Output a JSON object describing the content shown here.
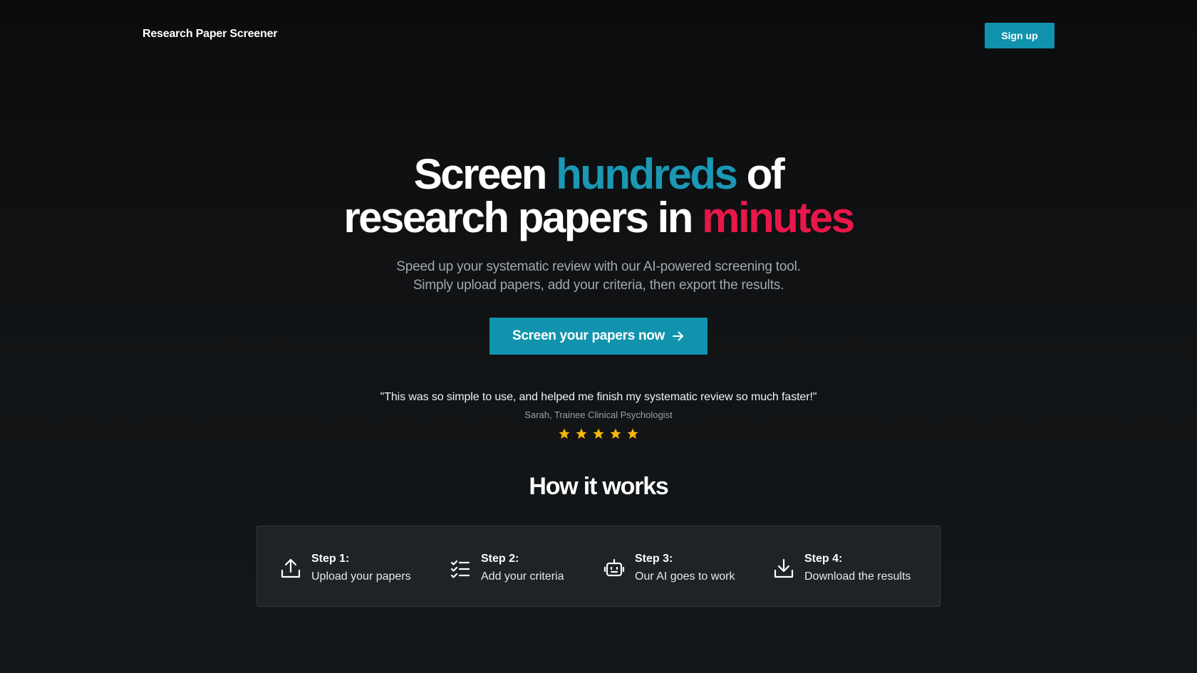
{
  "nav": {
    "brand": "Research Paper Screener",
    "signup_label": "Sign up"
  },
  "hero": {
    "headline": {
      "part1": "Screen ",
      "highlight1": "hundreds",
      "part2": " of",
      "part3": "research papers in ",
      "highlight2": "minutes"
    },
    "subtitle_line1": "Speed up your systematic review with our AI-powered screening tool.",
    "subtitle_line2": "Simply upload papers, add your criteria, then export the results.",
    "cta_label": "Screen your papers now"
  },
  "testimonial": {
    "quote": "\"This was so simple to use, and helped me finish my systematic review so much faster!\"",
    "author": "Sarah, Trainee Clinical Psychologist",
    "rating": 5
  },
  "how_it_works": {
    "title": "How it works",
    "steps": [
      {
        "label": "Step 1:",
        "desc": "Upload your papers",
        "icon": "upload-icon"
      },
      {
        "label": "Step 2:",
        "desc": "Add your criteria",
        "icon": "checklist-icon"
      },
      {
        "label": "Step 3:",
        "desc": "Our AI goes to work",
        "icon": "robot-icon"
      },
      {
        "label": "Step 4:",
        "desc": "Download the results",
        "icon": "download-icon"
      }
    ]
  },
  "colors": {
    "accent_teal": "#1193ad",
    "highlight_teal": "#1a98b4",
    "highlight_red": "#e8174a",
    "star": "#f5b50a",
    "background": "#101214"
  }
}
